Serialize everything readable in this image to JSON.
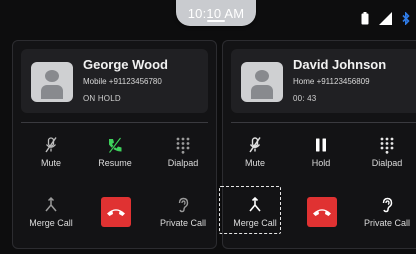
{
  "status_bar": {
    "time": "10:10 AM",
    "icons": [
      "battery-icon",
      "signal-icon",
      "bluetooth-icon"
    ]
  },
  "calls": [
    {
      "name": "George Wood",
      "number": "Mobile +91123456780",
      "status": "ON HOLD",
      "buttons": {
        "mute": "Mute",
        "resume": "Resume",
        "dialpad": "Dialpad",
        "merge": "Merge Call",
        "private": "Private Call"
      }
    },
    {
      "name": "David Johnson",
      "number": "Home +91123456809",
      "status": "00: 43",
      "buttons": {
        "mute": "Mute",
        "hold": "Hold",
        "dialpad": "Dialpad",
        "merge": "Merge Call",
        "private": "Private Call"
      }
    }
  ],
  "colors": {
    "resume_accent": "#3ed15c",
    "end_call": "#e03232",
    "background": "#0d0d0e"
  }
}
